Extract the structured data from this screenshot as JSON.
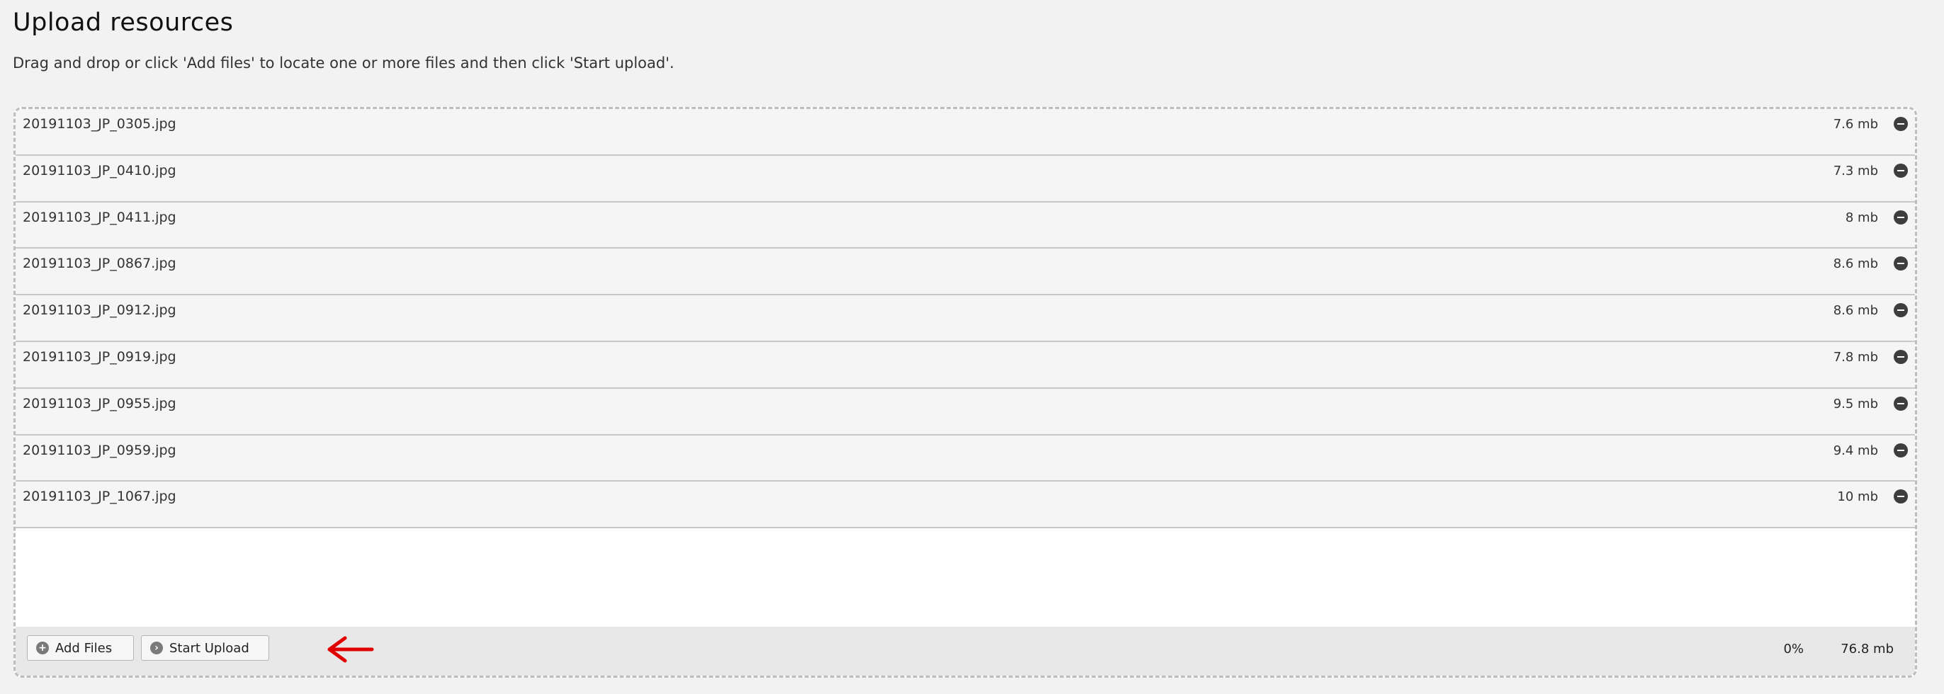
{
  "page": {
    "title": "Upload resources",
    "instructions": "Drag and drop or click 'Add files' to locate one or more files and then click 'Start upload'."
  },
  "files": [
    {
      "name": "20191103_JP_0305.jpg",
      "size": "7.6 mb"
    },
    {
      "name": "20191103_JP_0410.jpg",
      "size": "7.3 mb"
    },
    {
      "name": "20191103_JP_0411.jpg",
      "size": "8 mb"
    },
    {
      "name": "20191103_JP_0867.jpg",
      "size": "8.6 mb"
    },
    {
      "name": "20191103_JP_0912.jpg",
      "size": "8.6 mb"
    },
    {
      "name": "20191103_JP_0919.jpg",
      "size": "7.8 mb"
    },
    {
      "name": "20191103_JP_0955.jpg",
      "size": "9.5 mb"
    },
    {
      "name": "20191103_JP_0959.jpg",
      "size": "9.4 mb"
    },
    {
      "name": "20191103_JP_1067.jpg",
      "size": "10 mb"
    }
  ],
  "footer": {
    "add_files_label": "Add Files",
    "start_upload_label": "Start Upload",
    "progress_percent": "0%",
    "total_size": "76.8 mb"
  },
  "icons": {
    "remove": "minus-circle-icon",
    "add": "plus-circle-icon",
    "start": "arrow-circle-icon",
    "pointer": "red-arrow-left-icon"
  },
  "colors": {
    "arrow": "#e00000",
    "remove_icon": "#3d3d3d"
  }
}
